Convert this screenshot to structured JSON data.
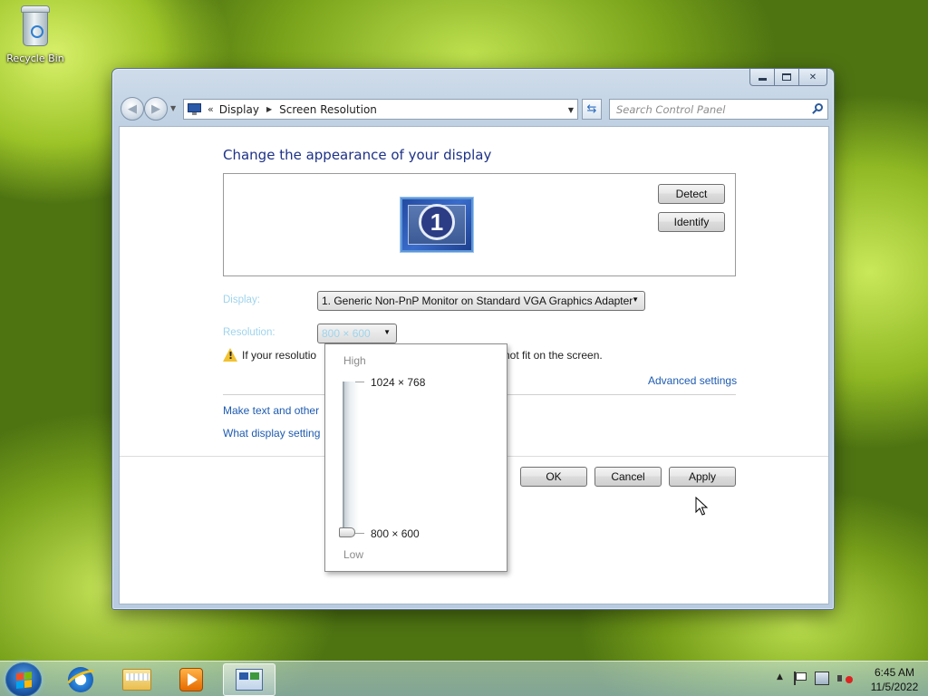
{
  "desktop": {
    "icons": [
      {
        "label": "Recycle Bin",
        "icon": "recycle-bin-icon"
      }
    ]
  },
  "window": {
    "caption_buttons": [
      "minimize",
      "maximize",
      "close"
    ],
    "address": {
      "prefix": "«",
      "breadcrumbs": [
        "Display",
        "Screen Resolution"
      ]
    },
    "search": {
      "placeholder": "Search Control Panel"
    },
    "content": {
      "title": "Change the appearance of your display",
      "monitor_number": "1",
      "detect_label": "Detect",
      "identify_label": "Identify",
      "display_label": "Display:",
      "display_value": "1. Generic Non-PnP Monitor on Standard VGA Graphics Adapter",
      "resolution_label": "Resolution:",
      "resolution_value": "800 × 600",
      "warning_left": "If your resolutio",
      "warning_right": "not fit on the screen.",
      "advanced_link": "Advanced settings",
      "link_text_size": "Make text and other",
      "link_settings": "What display setting",
      "ok_label": "OK",
      "cancel_label": "Cancel",
      "apply_label": "Apply"
    },
    "resolution_popup": {
      "high_label": "High",
      "low_label": "Low",
      "max_resolution": "1024 × 768",
      "min_resolution": "800 × 600",
      "slider_level": 0
    }
  },
  "taskbar": {
    "pinned": [
      "internet-explorer-icon",
      "windows-explorer-icon",
      "media-player-icon",
      "control-panel-icon"
    ],
    "active": "control-panel-icon",
    "clock": {
      "time": "6:45 AM",
      "date": "11/5/2022"
    }
  },
  "colors": {
    "title_blue": "#1e3287",
    "link_blue": "#1e5bb0",
    "disabled_label": "#9fd4ec"
  }
}
